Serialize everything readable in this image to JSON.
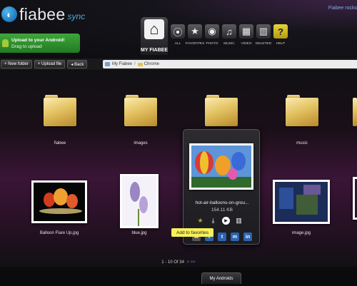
{
  "brand": {
    "name": "fiabee",
    "suffix": "sync",
    "top_right_link": "Fiabee rocks"
  },
  "upload": {
    "line1": "Upload to your Android!",
    "line2": "Drag to upload"
  },
  "nav": {
    "home_label": "MY FIABEE",
    "items": [
      {
        "icon": "circle-p-icon",
        "glyph": "⦿",
        "label": "ALL"
      },
      {
        "icon": "star-icon",
        "glyph": "★",
        "label": "FAVORITES"
      },
      {
        "icon": "camera-icon",
        "glyph": "📷",
        "label": "PHOTO"
      },
      {
        "icon": "music-icon",
        "glyph": "♫",
        "label": "MUSIC"
      },
      {
        "icon": "film-icon",
        "glyph": "▦",
        "label": "VIDEO"
      },
      {
        "icon": "trash-icon",
        "glyph": "🗑",
        "label": "DELETED"
      },
      {
        "icon": "help-icon",
        "glyph": "?",
        "label": "HELP"
      }
    ]
  },
  "toolbar": {
    "new_folder": "+ New folder",
    "upload_file": "+ Upload file",
    "back": "◂ Back",
    "breadcrumb_root": "My Fiabee",
    "breadcrumb_current": "Chrome"
  },
  "folders": [
    "fiabee",
    "images",
    "",
    "music",
    ""
  ],
  "files": [
    {
      "name": "Balloon Flare Up.jpg"
    },
    {
      "name": "blue.jpg"
    },
    {
      "name": "image.jpg"
    }
  ],
  "popup": {
    "title": "hot-air-balloons-on-grou...",
    "size": "154.11 KB",
    "tooltip": "Add to favorites"
  },
  "pager": {
    "text": "1 - 10 Of 34",
    "next": "> >>"
  },
  "footer": {
    "my_androids": "My Androids"
  },
  "colors": {
    "accent": "#4fa9e0",
    "upload_green": "#3ea63a",
    "tooltip": "#f7f05a"
  }
}
